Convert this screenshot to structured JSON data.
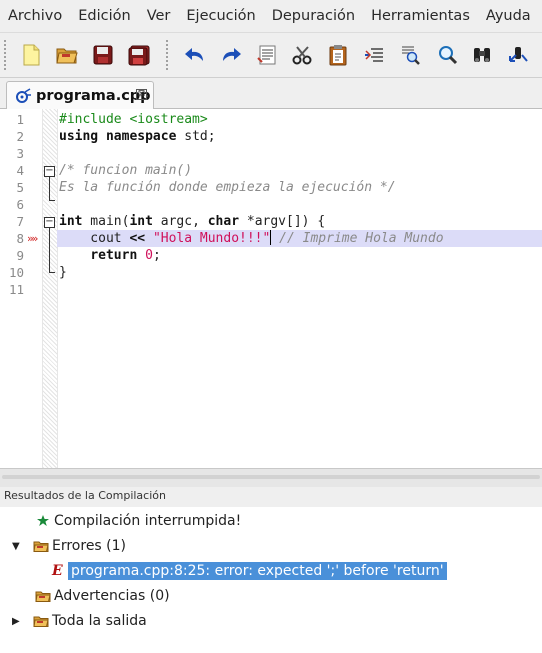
{
  "menu": [
    "Archivo",
    "Edición",
    "Ver",
    "Ejecución",
    "Depuración",
    "Herramientas",
    "Ayuda"
  ],
  "toolbar": {
    "buttons": [
      "new-file",
      "open-file",
      "save",
      "save-all",
      "undo",
      "redo",
      "paste-list",
      "cut",
      "paste",
      "comment",
      "find-list",
      "find",
      "binoculars",
      "replace"
    ]
  },
  "tab": {
    "title": "programa.cpp",
    "close_symbol": "⊠"
  },
  "editor": {
    "line_numbers": [
      "1",
      "2",
      "3",
      "4",
      "5",
      "6",
      "7",
      "8",
      "9",
      "10",
      "11"
    ],
    "lines": {
      "l1": "#include <iostream>",
      "l2_kw1": "using",
      "l2_kw2": "namespace",
      "l2_rest": " std;",
      "l4": "/* funcion main()",
      "l5": "Es la función donde empieza la ejecución */",
      "l7_kw1": "int",
      "l7_a": " main(",
      "l7_kw2": "int",
      "l7_b": " argc, ",
      "l7_kw3": "char",
      "l7_c": " *argv[]) {",
      "l8_indent": "    cout ",
      "l8_op": "<<",
      "l8_sp": " ",
      "l8_str": "\"Hola Mundo!!!\"",
      "l8_com": " // Imprime Hola Mundo",
      "l9_indent": "    ",
      "l9_kw": "return",
      "l9_sp": " ",
      "l9_num": "0",
      "l9_end": ";",
      "l10": "}"
    },
    "breakpoint_marker": "»»",
    "fold_symbol": "−",
    "highlighted_line": 8
  },
  "results_panel": {
    "title": "Resultados de la Compilación",
    "items": {
      "status": "Compilación interrumpida!",
      "errors": "Errores (1)",
      "error_detail": "programa.cpp:8:25: error: expected ';' before 'return'",
      "error_prefix": "E",
      "warnings": "Advertencias (0)",
      "all_output": "Toda la salida"
    },
    "expanded_symbol": "▼",
    "collapsed_symbol": "▶",
    "colors": {
      "selection": "#4a90d9",
      "error": "#b01010"
    }
  }
}
